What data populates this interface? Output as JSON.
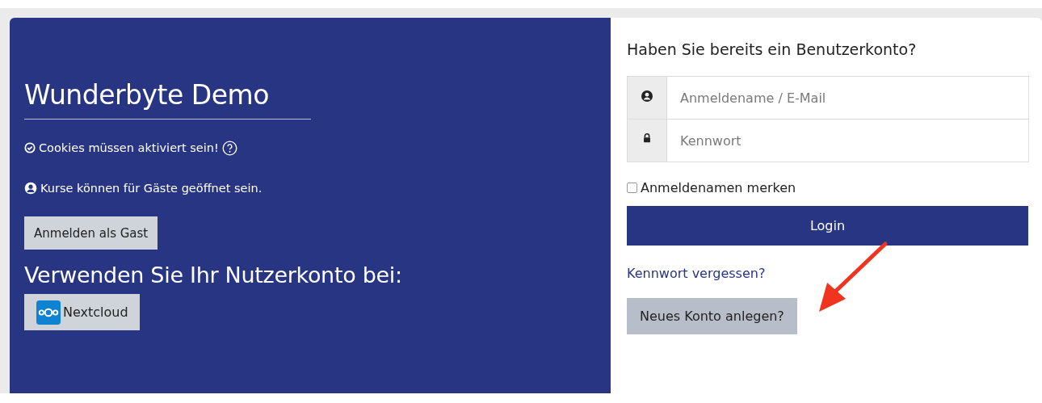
{
  "left_panel": {
    "title": "Wunderbyte Demo",
    "notices": [
      {
        "kind": "cookies",
        "text": "Cookies müssen aktiviert sein!",
        "help": true
      },
      {
        "kind": "guest",
        "text": "Kurse können für Gäste geöffnet sein.",
        "help": false
      }
    ],
    "guest_button": "Anmelden als Gast",
    "providers_heading": "Verwenden Sie Ihr Nutzerkonto bei:",
    "providers": [
      {
        "label": "Nextcloud"
      }
    ]
  },
  "login_panel": {
    "heading": "Haben Sie bereits ein Benutzerkonto?",
    "fields": [
      {
        "kind": "user",
        "placeholder": "Anmeldename / E-Mail"
      },
      {
        "kind": "password",
        "placeholder": "Kennwort"
      }
    ],
    "remember": {
      "label": "Anmeldenamen merken",
      "checked": false
    },
    "login_button": "Login",
    "forgot_link": "Kennwort vergessen?",
    "signup_button": "Neues Konto anlegen?"
  }
}
